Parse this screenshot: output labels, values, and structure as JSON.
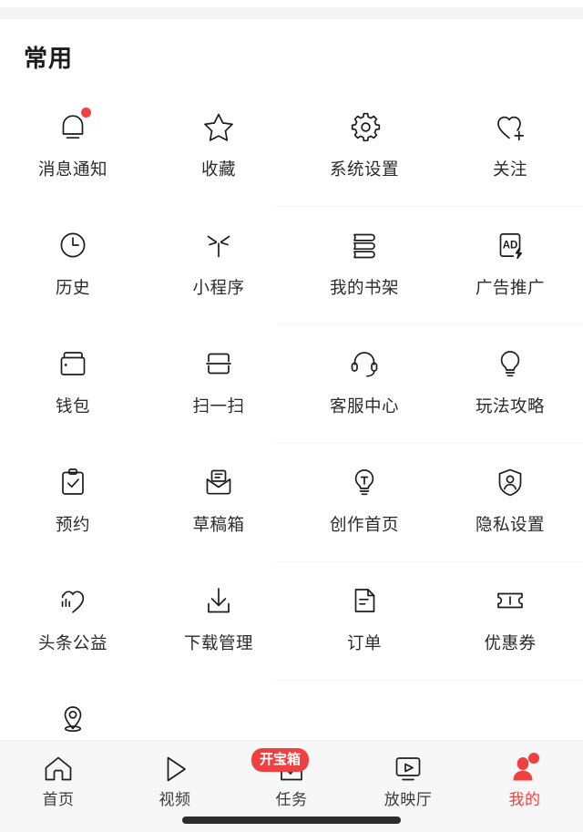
{
  "section": {
    "title": "常用"
  },
  "shortcuts": [
    {
      "label": "消息通知",
      "icon": "bell-icon",
      "badge_dot": true
    },
    {
      "label": "收藏",
      "icon": "star-icon",
      "badge_dot": false
    },
    {
      "label": "系统设置",
      "icon": "gear-icon",
      "badge_dot": false
    },
    {
      "label": "关注",
      "icon": "heart-plus-icon",
      "badge_dot": false
    },
    {
      "label": "历史",
      "icon": "clock-icon",
      "badge_dot": false
    },
    {
      "label": "小程序",
      "icon": "mini-program-icon",
      "badge_dot": false
    },
    {
      "label": "我的书架",
      "icon": "bookshelf-icon",
      "badge_dot": false
    },
    {
      "label": "广告推广",
      "icon": "ad-promo-icon",
      "badge_dot": false
    },
    {
      "label": "钱包",
      "icon": "wallet-icon",
      "badge_dot": false
    },
    {
      "label": "扫一扫",
      "icon": "scan-icon",
      "badge_dot": false
    },
    {
      "label": "客服中心",
      "icon": "headset-icon",
      "badge_dot": false
    },
    {
      "label": "玩法攻略",
      "icon": "bulb-icon",
      "badge_dot": false
    },
    {
      "label": "预约",
      "icon": "clipboard-check-icon",
      "badge_dot": false
    },
    {
      "label": "草稿箱",
      "icon": "draft-envelope-icon",
      "badge_dot": false
    },
    {
      "label": "创作首页",
      "icon": "bulb-create-icon",
      "badge_dot": false
    },
    {
      "label": "隐私设置",
      "icon": "shield-user-icon",
      "badge_dot": false
    },
    {
      "label": "头条公益",
      "icon": "charity-heart-icon",
      "badge_dot": false
    },
    {
      "label": "下载管理",
      "icon": "download-icon",
      "badge_dot": false
    },
    {
      "label": "订单",
      "icon": "document-icon",
      "badge_dot": false
    },
    {
      "label": "优惠券",
      "icon": "coupon-icon",
      "badge_dot": false
    },
    {
      "label": "",
      "icon": "location-pin-icon",
      "badge_dot": false
    }
  ],
  "tabbar": {
    "items": [
      {
        "label": "首页",
        "icon": "home-icon",
        "active": false,
        "badge": "",
        "dot": false
      },
      {
        "label": "视频",
        "icon": "play-icon",
        "active": false,
        "badge": "",
        "dot": false
      },
      {
        "label": "任务",
        "icon": "task-icon",
        "active": false,
        "badge": "开宝箱",
        "dot": false
      },
      {
        "label": "放映厅",
        "icon": "theater-icon",
        "active": false,
        "badge": "",
        "dot": false
      },
      {
        "label": "我的",
        "icon": "profile-icon",
        "active": true,
        "badge": "",
        "dot": true
      }
    ]
  },
  "colors": {
    "accent": "#f04142",
    "icon_stroke": "#1d1d1f",
    "label_text": "#2b2b2b",
    "tabbar_bg": "#f7f7f7",
    "page_bg": "#ffffff",
    "divider": "#f7f7f8"
  }
}
